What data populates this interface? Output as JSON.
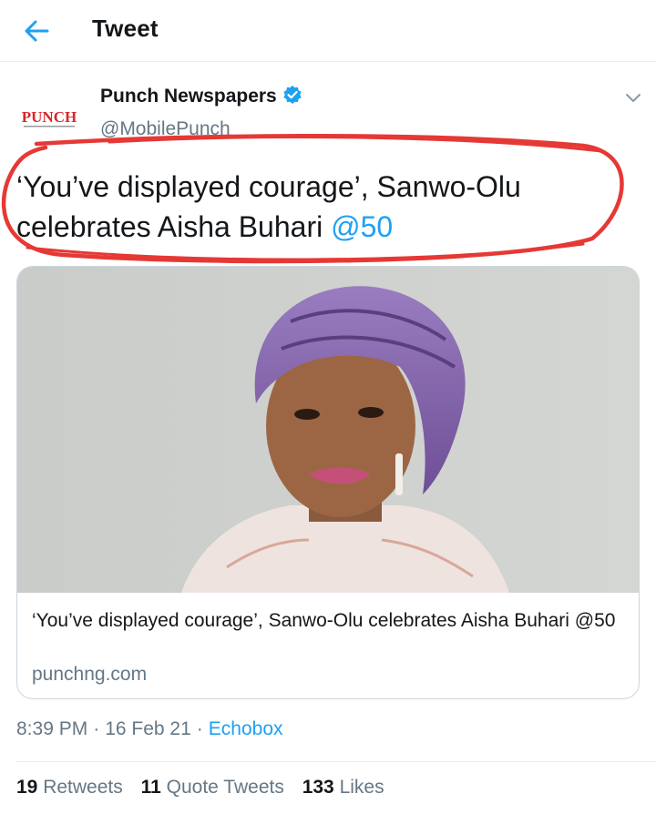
{
  "header": {
    "title": "Tweet",
    "back_icon": "arrow-left-icon"
  },
  "tweet": {
    "author": {
      "name": "Punch Newspapers",
      "handle": "@MobilePunch",
      "verified": true,
      "avatar_text": "PUNCH"
    },
    "text": "‘You’ve displayed courage’, Sanwo-Olu celebrates Aisha Buhari ",
    "mention": "@50",
    "card": {
      "title": "‘You’ve displayed courage’, Sanwo-Olu celebrates Aisha Buhari @50",
      "domain": "punchng.com"
    },
    "time": "8:39 PM",
    "date": "16 Feb 21",
    "source": "Echobox",
    "separator": "·",
    "stats": {
      "retweets_count": "19",
      "retweets_label": "Retweets",
      "quotes_count": "11",
      "quotes_label": "Quote Tweets",
      "likes_count": "133",
      "likes_label": "Likes"
    }
  },
  "colors": {
    "accent": "#1da1f2",
    "text": "#14171a",
    "muted": "#657786",
    "annotation": "#e53935",
    "punch_red": "#d7262c"
  }
}
